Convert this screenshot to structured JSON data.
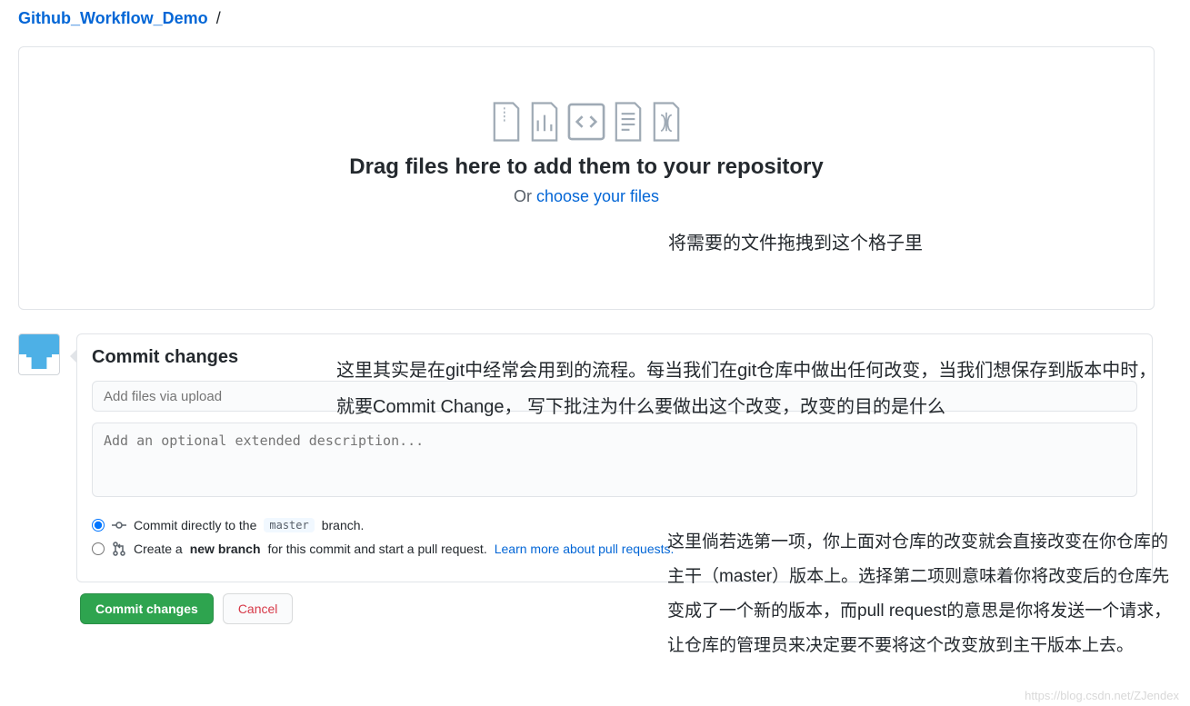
{
  "breadcrumb": {
    "repo": "Github_Workflow_Demo",
    "sep": "/"
  },
  "dropzone": {
    "title": "Drag files here to add them to your repository",
    "or": "Or ",
    "choose": "choose your files",
    "annot": "将需要的文件拖拽到这个格子里"
  },
  "commit": {
    "heading": "Commit changes",
    "summary_placeholder": "Add files via upload",
    "desc_placeholder": "Add an optional extended description...",
    "radio1_pre": "Commit directly to the ",
    "radio1_branch": "master",
    "radio1_post": " branch.",
    "radio2_pre": "Create a ",
    "radio2_bold": "new branch",
    "radio2_post": " for this commit and start a pull request. ",
    "radio2_link": "Learn more about pull requests.",
    "btn_commit": "Commit changes",
    "btn_cancel": "Cancel"
  },
  "annot_commit": "这里其实是在git中经常会用到的流程。每当我们在git仓库中做出任何改变，当我们想保存到版本中时，就要Commit Change， 写下批注为什么要做出这个改变，改变的目的是什么",
  "annot_branch": "这里倘若选第一项，你上面对仓库的改变就会直接改变在你仓库的主干（master）版本上。选择第二项则意味着你将改变后的仓库先变成了一个新的版本，而pull request的意思是你将发送一个请求， 让仓库的管理员来决定要不要将这个改变放到主干版本上去。",
  "watermark": "https://blog.csdn.net/ZJendex"
}
